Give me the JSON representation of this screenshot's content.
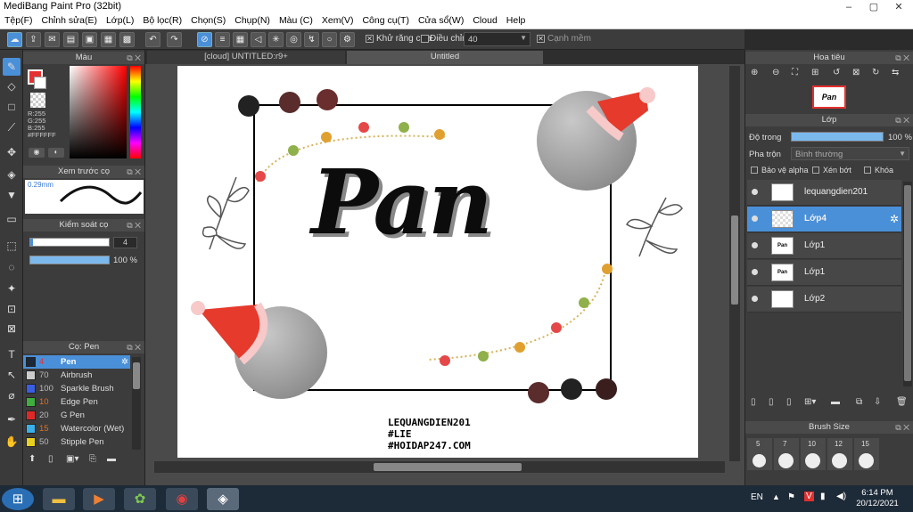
{
  "window": {
    "title": "MediBang Paint Pro (32bit)",
    "min": "–",
    "max": "▢",
    "close": "✕"
  },
  "menu": [
    "Tệp(F)",
    "Chỉnh sửa(E)",
    "Lớp(L)",
    "Bộ lọc(R)",
    "Chọn(S)",
    "Chụp(N)",
    "Màu (C)",
    "Xem(V)",
    "Công cụ(T)",
    "Cửa sổ(W)",
    "Cloud",
    "Help"
  ],
  "toolbar": {
    "antialias_label": "Khử răng cưa",
    "adjust_label": "Điều chỉnh",
    "adjust_value": "40",
    "snap_label": "Cạnh mềm"
  },
  "tabs": [
    "[cloud] UNTITLED:r9+",
    "Untitled"
  ],
  "color_panel": {
    "title": "Màu",
    "r": "R:255",
    "g": "G:255",
    "b": "B:255",
    "hex": "#FFFFFF",
    "fg_color": "#e53030",
    "bg_color": "#ffffff"
  },
  "preview_panel": {
    "title": "Xem trước cọ",
    "size": "0.29mm"
  },
  "brush_control": {
    "title": "Kiểm soát cọ",
    "size_value": "4",
    "opacity_value": "100 %"
  },
  "brush_panel": {
    "title": "Cọ: Pen",
    "items": [
      {
        "num": "4",
        "name": "Pen",
        "color": "#1b2838"
      },
      {
        "num": "70",
        "name": "Airbrush",
        "color": "#cccccc"
      },
      {
        "num": "100",
        "name": "Sparkle Brush",
        "color": "#3a5ee0"
      },
      {
        "num": "10",
        "name": "Edge Pen",
        "color": "#3fae3f"
      },
      {
        "num": "20",
        "name": "G Pen",
        "color": "#e02828"
      },
      {
        "num": "15",
        "name": "Watercolor (Wet)",
        "color": "#3ab0e8"
      },
      {
        "num": "50",
        "name": "Stipple Pen",
        "color": "#e8d020"
      }
    ]
  },
  "canvas": {
    "main_text": "Pan",
    "credit_lines": [
      "LEQUANGDIEN201",
      "#LIE",
      "#HOIDAP247.COM"
    ]
  },
  "navigator": {
    "title": "Hoa tiêu",
    "thumb_text": "Pan"
  },
  "layer_panel": {
    "title": "Lớp",
    "opacity_label": "Độ trong",
    "opacity_value": "100 %",
    "opacity_fraction": 1.0,
    "blend_label": "Pha trộn",
    "blend_value": "Bình thường",
    "protect_alpha": "Bảo vệ alpha",
    "clipping": "Xén bớt",
    "lock": "Khóa",
    "layers": [
      {
        "name": "lequangdien201",
        "thumb": ""
      },
      {
        "name": "Lớp4",
        "thumb": ""
      },
      {
        "name": "Lớp1",
        "thumb": "Pan"
      },
      {
        "name": "Lớp1",
        "thumb": "Pan"
      },
      {
        "name": "Lớp2",
        "thumb": ""
      }
    ]
  },
  "brush_size": {
    "title": "Brush Size",
    "sizes": [
      "5",
      "7",
      "10",
      "12",
      "15"
    ]
  },
  "tray": {
    "lang": "EN",
    "time": "6:14 PM",
    "date": "20/12/2021"
  }
}
